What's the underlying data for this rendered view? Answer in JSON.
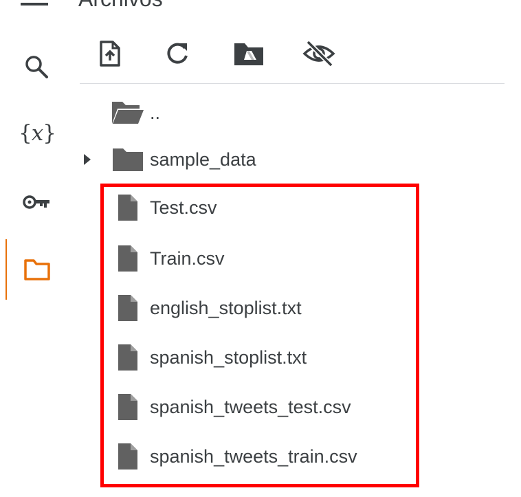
{
  "header": {
    "title": "Archivos"
  },
  "colors": {
    "active_accent": "#e8710a",
    "icon_gray": "#3c4043",
    "file_icon_fill": "#616161",
    "highlight_border": "#ff0000"
  },
  "rail": {
    "items": [
      {
        "icon": "search-icon"
      },
      {
        "icon": "variables-icon",
        "glyph_open": "{",
        "glyph_var": "x",
        "glyph_close": "}"
      },
      {
        "icon": "key-icon"
      },
      {
        "icon": "folder-icon",
        "active": true
      }
    ]
  },
  "toolbar": {
    "buttons": [
      {
        "icon": "upload-file-icon"
      },
      {
        "icon": "refresh-icon"
      },
      {
        "icon": "mount-drive-icon"
      },
      {
        "icon": "hide-hidden-files-icon"
      }
    ]
  },
  "tree": {
    "parent": {
      "label": ".."
    },
    "folders": [
      {
        "label": "sample_data",
        "expanded": false
      }
    ],
    "files": [
      {
        "label": "Test.csv"
      },
      {
        "label": "Train.csv"
      },
      {
        "label": "english_stoplist.txt"
      },
      {
        "label": "spanish_stoplist.txt"
      },
      {
        "label": "spanish_tweets_test.csv"
      },
      {
        "label": "spanish_tweets_train.csv"
      }
    ]
  }
}
